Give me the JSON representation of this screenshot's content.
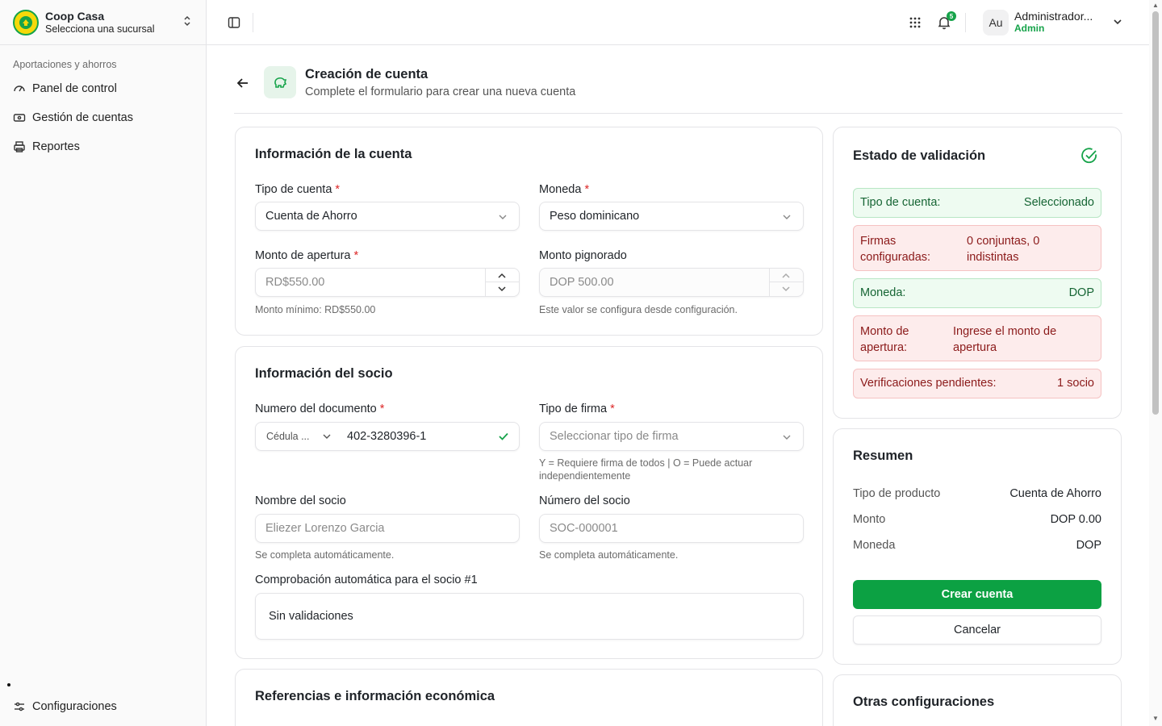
{
  "org": {
    "name": "Coop Casa",
    "subtitle": "Selecciona una sucursal"
  },
  "sidebar": {
    "section": "Aportaciones y ahorros",
    "items": [
      {
        "label": "Panel de control",
        "icon": "gauge-icon"
      },
      {
        "label": "Gestión de cuentas",
        "icon": "banknote-icon"
      },
      {
        "label": "Reportes",
        "icon": "printer-icon"
      }
    ],
    "bottom_item": {
      "label": "Configuraciones",
      "icon": "settings-icon"
    }
  },
  "topbar": {
    "notifications_count": "5",
    "avatar_initials": "Au",
    "user_name": "Administrador...",
    "user_role": "Admin"
  },
  "page": {
    "title": "Creación de cuenta",
    "subtitle": "Complete el formulario para crear una nueva cuenta"
  },
  "account_info": {
    "title": "Información de la cuenta",
    "tipo_cuenta_label": "Tipo de cuenta",
    "tipo_cuenta_value": "Cuenta de Ahorro",
    "moneda_label": "Moneda",
    "moneda_value": "Peso dominicano",
    "monto_apertura_label": "Monto de apertura",
    "monto_apertura_placeholder": "RD$550.00",
    "monto_apertura_help": "Monto mínimo: RD$550.00",
    "monto_pignorado_label": "Monto pignorado",
    "monto_pignorado_placeholder": "DOP 500.00",
    "monto_pignorado_help": "Este valor se configura desde configuración."
  },
  "partner_info": {
    "title": "Información del socio",
    "doc_label": "Numero del documento",
    "doc_type": "Cédula ...",
    "doc_value": "402-3280396-1",
    "firma_label": "Tipo de firma",
    "firma_placeholder": "Seleccionar tipo de firma",
    "firma_help": "Y = Requiere firma de todos | O = Puede actuar independientemente",
    "nombre_label": "Nombre del socio",
    "nombre_value": "Eliezer Lorenzo Garcia",
    "nombre_help": "Se completa automáticamente.",
    "numero_label": "Número del socio",
    "numero_value": "SOC-000001",
    "numero_help": "Se completa automáticamente.",
    "check_label": "Comprobación automática para el socio #1",
    "check_value": "Sin validaciones"
  },
  "references": {
    "title": "Referencias e información económica"
  },
  "validation": {
    "title": "Estado de validación",
    "rows": [
      {
        "label": "Tipo de cuenta:",
        "value": "Seleccionado",
        "status": "ok"
      },
      {
        "label": "Firmas configuradas:",
        "value": "0 conjuntas, 0 indistintas",
        "status": "error"
      },
      {
        "label": "Moneda:",
        "value": "DOP",
        "status": "ok"
      },
      {
        "label": "Monto de apertura:",
        "value": "Ingrese el monto de apertura",
        "status": "error"
      },
      {
        "label": "Verificaciones pendientes:",
        "value": "1 socio",
        "status": "error"
      }
    ]
  },
  "summary": {
    "title": "Resumen",
    "rows": [
      {
        "k": "Tipo de producto",
        "v": "Cuenta de Ahorro"
      },
      {
        "k": "Monto",
        "v": "DOP 0.00"
      },
      {
        "k": "Moneda",
        "v": "DOP"
      }
    ],
    "create_label": "Crear cuenta",
    "cancel_label": "Cancelar"
  },
  "other": {
    "title": "Otras configuraciones"
  },
  "colors": {
    "accent": "#0ca143",
    "error_bg": "#fdecec",
    "ok_bg": "#eefbf1"
  }
}
